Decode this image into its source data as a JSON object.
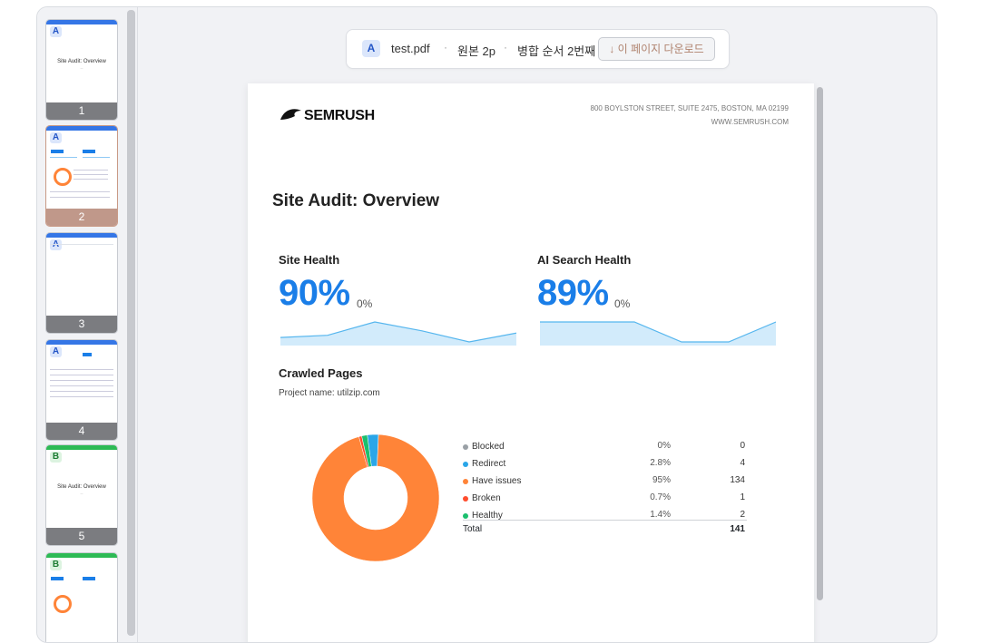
{
  "sidebar": {
    "thumbnails": [
      {
        "badge": "A",
        "number": "1",
        "color": "#3576e6",
        "mini_title": "Site Audit: Overview",
        "selected": false
      },
      {
        "badge": "A",
        "number": "2",
        "color": "#3576e6",
        "selected": true
      },
      {
        "badge": "A",
        "number": "3",
        "color": "#3576e6",
        "selected": false
      },
      {
        "badge": "A",
        "number": "4",
        "color": "#3576e6",
        "selected": false
      },
      {
        "badge": "B",
        "number": "5",
        "color": "#2dba55",
        "mini_title": "Site Audit: Overview",
        "selected": false
      },
      {
        "badge": "B",
        "number": "6",
        "color": "#2dba55",
        "selected": false
      }
    ]
  },
  "header": {
    "badge": "A",
    "filename": "test.pdf",
    "separator": "·",
    "original": "원본 2p",
    "merge_order": "병합 순서 2번째",
    "download_label": "↓ 이 페이지 다운로드"
  },
  "document": {
    "logo": "SEMRUSH",
    "address_line1": "800 BOYLSTON STREET, SUITE 2475, BOSTON, MA 02199",
    "address_line2": "WWW.SEMRUSH.COM",
    "title": "Site Audit: Overview",
    "site_health": {
      "label": "Site Health",
      "value": "90%",
      "delta": "0%",
      "trend": [
        2,
        3,
        9,
        5,
        0,
        4
      ]
    },
    "ai_health": {
      "label": "AI Search Health",
      "value": "89%",
      "delta": "0%",
      "trend": [
        9,
        9,
        9,
        0,
        0,
        9
      ]
    },
    "crawled_title": "Crawled Pages",
    "project": "Project name: utilzip.com",
    "chart_data": {
      "type": "pie",
      "categories": [
        "Blocked",
        "Redirect",
        "Have issues",
        "Broken",
        "Healthy"
      ],
      "values": [
        0,
        4,
        134,
        1,
        2
      ],
      "percents": [
        "0%",
        "2.8%",
        "95%",
        "0.7%",
        "1.4%"
      ],
      "counts": [
        "0",
        "4",
        "134",
        "1",
        "2"
      ],
      "colors": [
        "#9aa0a6",
        "#2aa6e8",
        "#ff8438",
        "#ff4d2e",
        "#1bbf6e"
      ],
      "total_label": "Total",
      "total": "141"
    }
  }
}
